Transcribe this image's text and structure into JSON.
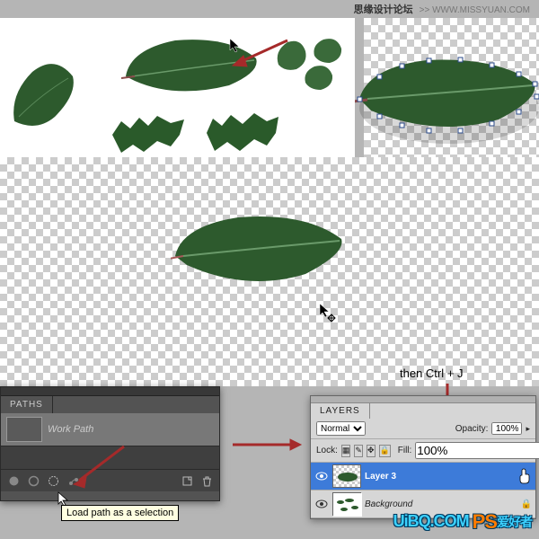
{
  "header": {
    "site_cn": "思缘设计论坛",
    "site_url": ">> WWW.MISSYUAN.COM"
  },
  "paths_panel": {
    "tab": "PATHS",
    "item_name": "Work Path",
    "tooltip": "Load path as a selection"
  },
  "layers_panel": {
    "tab": "LAYERS",
    "blend_mode": "Normal",
    "opacity_label": "Opacity:",
    "opacity_value": "100%",
    "lock_label": "Lock:",
    "fill_label": "Fill:",
    "fill_value": "100%",
    "layer3": "Layer 3",
    "background": "Background"
  },
  "instruction": "then Ctrl + J",
  "watermark": {
    "domain": "UiBQ",
    "tld": ".COM",
    "ps": "PS",
    "cn": "爱好者"
  }
}
